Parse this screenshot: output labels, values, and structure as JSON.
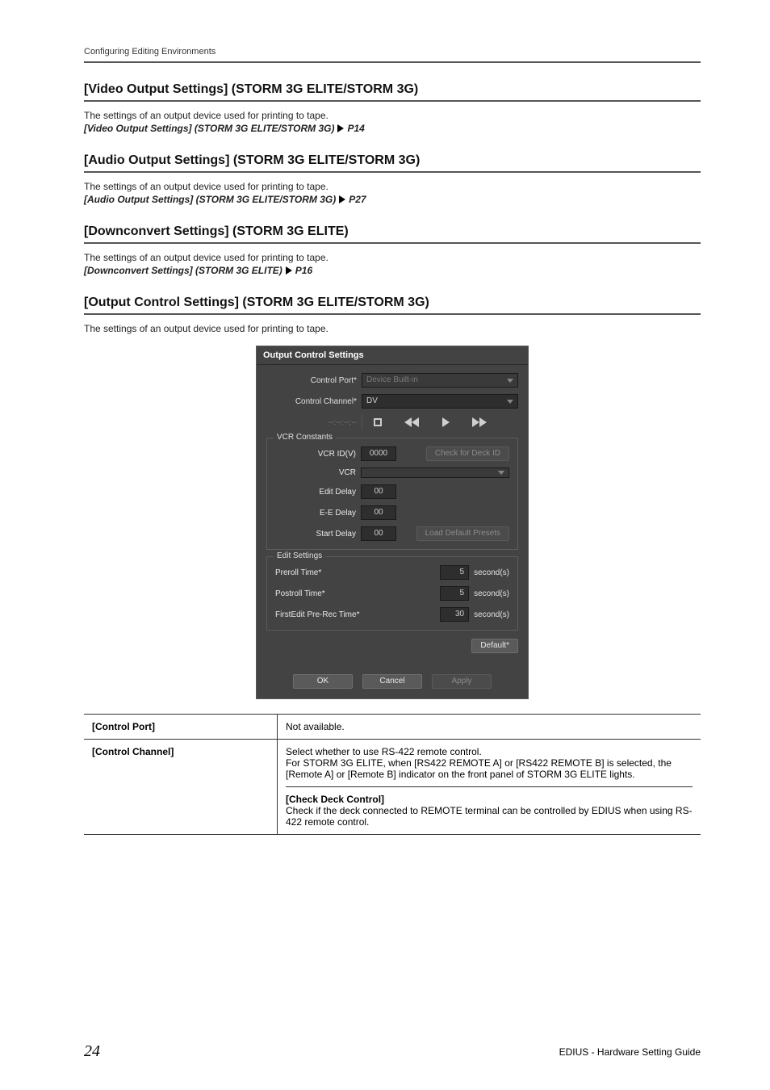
{
  "running_header": "Configuring Editing Environments",
  "s1": {
    "heading": "[Video Output Settings] (STORM 3G ELITE/STORM 3G)",
    "body": "The settings of an output device used for printing to tape.",
    "xref": "[Video Output Settings] (STORM 3G ELITE/STORM 3G)",
    "page": "P14"
  },
  "s2": {
    "heading": "[Audio Output Settings] (STORM 3G ELITE/STORM 3G)",
    "body": "The settings of an output device used for printing to tape.",
    "xref": "[Audio Output Settings] (STORM 3G ELITE/STORM 3G)",
    "page": "P27"
  },
  "s3": {
    "heading": "[Downconvert Settings] (STORM 3G ELITE)",
    "body": "The settings of an output device used for printing to tape.",
    "xref": "[Downconvert Settings] (STORM 3G ELITE)",
    "page": "P16"
  },
  "s4": {
    "heading": "[Output Control Settings] (STORM 3G ELITE/STORM 3G)",
    "body": "The settings of an output device used for printing to tape."
  },
  "dialog": {
    "title": "Output Control Settings",
    "control_port_label": "Control Port*",
    "control_port_value": "Device Built-in",
    "control_channel_label": "Control Channel*",
    "control_channel_value": "DV",
    "timecode_label": "--:--:--;--",
    "vcr_constants_legend": "VCR Constants",
    "vcr_id_label": "VCR ID(V)",
    "vcr_id_value": "0000",
    "check_deck_label": "Check for Deck ID",
    "vcr_label": "VCR",
    "vcr_value": "",
    "edit_delay_label": "Edit Delay",
    "edit_delay_value": "00",
    "ee_delay_label": "E-E Delay",
    "ee_delay_value": "00",
    "start_delay_label": "Start Delay",
    "start_delay_value": "00",
    "load_presets_label": "Load Default Presets",
    "edit_settings_legend": "Edit Settings",
    "preroll_label": "Preroll Time*",
    "preroll_value": "5",
    "postroll_label": "Postroll Time*",
    "postroll_value": "5",
    "firstedit_label": "FirstEdit Pre-Rec Time*",
    "firstedit_value": "30",
    "seconds_unit": "second(s)",
    "default_label": "Default*",
    "ok_label": "OK",
    "cancel_label": "Cancel",
    "apply_label": "Apply"
  },
  "table": {
    "r1_left": "[Control Port]",
    "r1_right": "Not available.",
    "r2_left": "[Control Channel]",
    "r2_right_p1": "Select whether to use RS-422 remote control.\nFor STORM 3G ELITE, when [RS422 REMOTE A] or [RS422 REMOTE B] is selected, the [Remote A] or [Remote B] indicator on the front panel of STORM 3G ELITE lights.",
    "r2_sub_heading": "[Check Deck Control]",
    "r2_sub_body": "Check if the deck connected to REMOTE terminal can be controlled by EDIUS when using RS-422 remote control."
  },
  "page_number": "24",
  "footer_right": "EDIUS - Hardware Setting Guide"
}
